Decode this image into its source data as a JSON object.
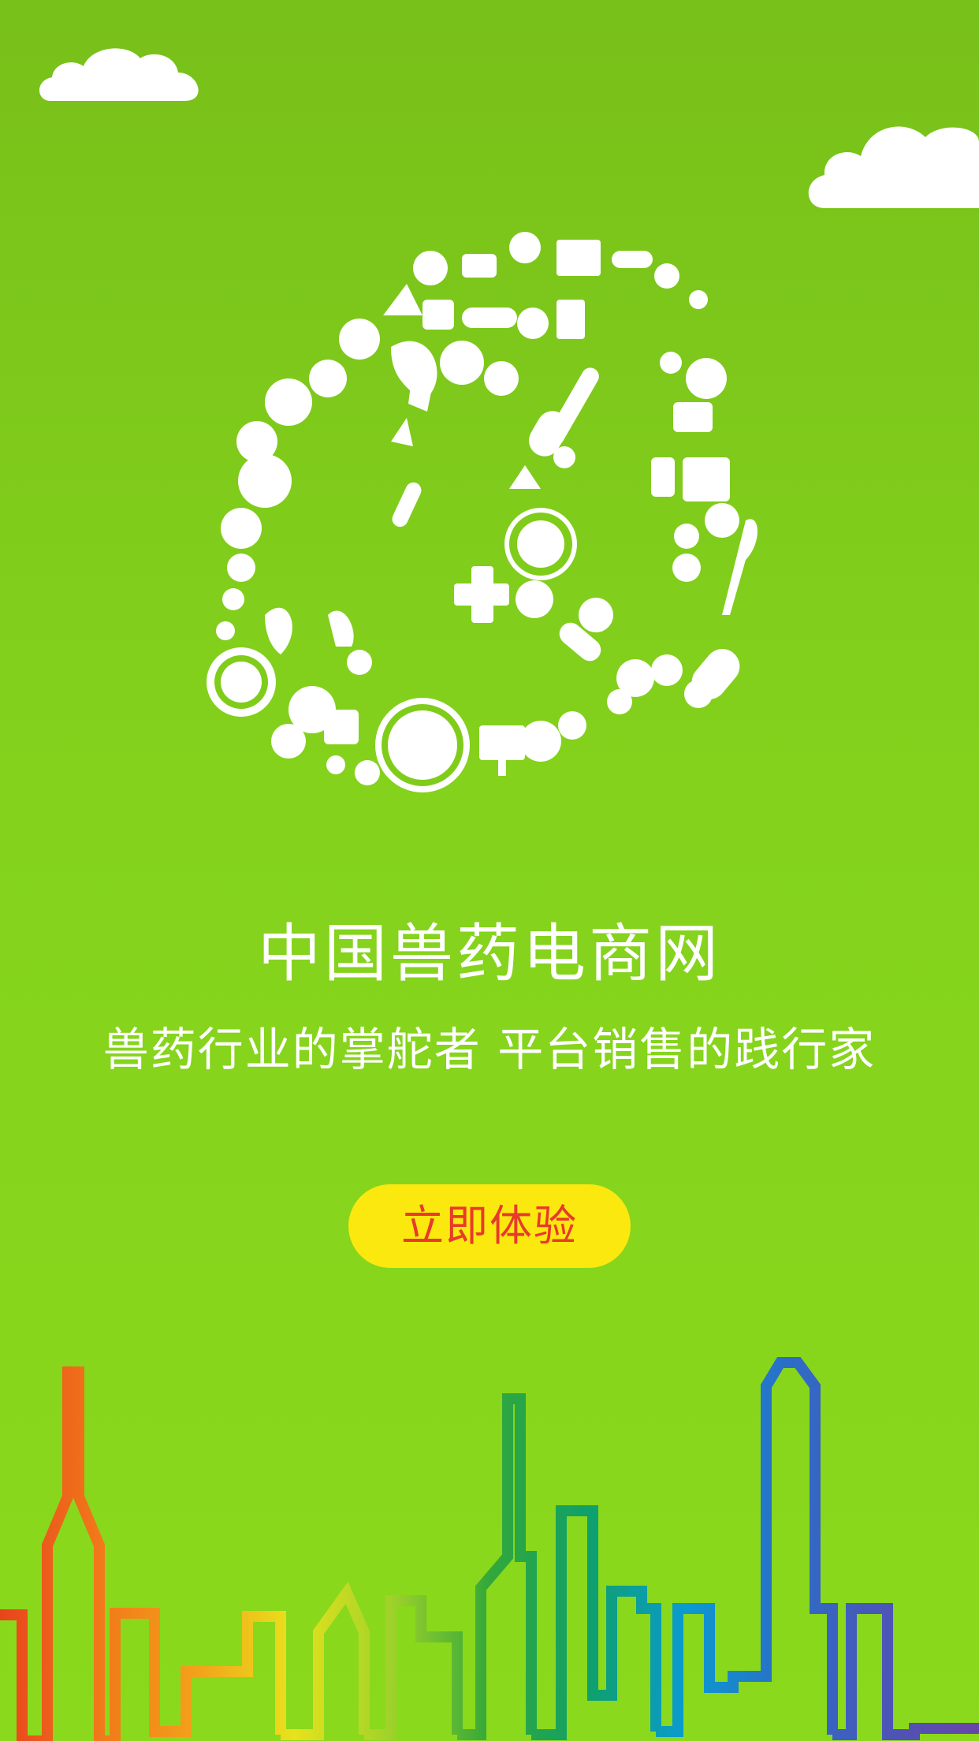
{
  "app": {
    "title": "中国兽药电商网",
    "slogan": "兽药行业的掌舵者  平台销售的践行家"
  },
  "cta": {
    "label": "立即体验"
  },
  "icons": {
    "logo": "animal-medicine-collage-logo-icon",
    "clouds": "cloud-icon",
    "skyline": "rainbow-city-skyline-icon"
  },
  "colors": {
    "background_top": "#78c01a",
    "background_bottom": "#8ad91c",
    "button_fill": "#fbe80f",
    "button_text": "#e83a2c",
    "text": "#ffffff"
  }
}
